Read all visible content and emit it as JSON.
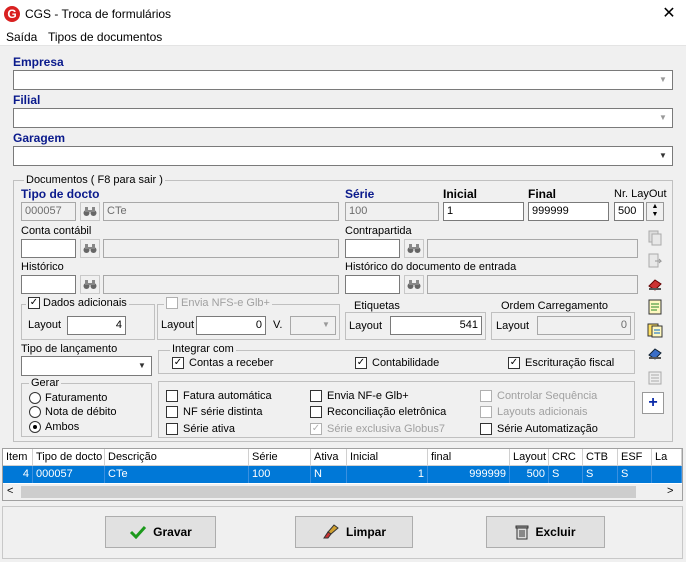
{
  "window": {
    "title": "CGS - Troca de formulários",
    "close": "✕",
    "logo_letter": "G"
  },
  "menu": [
    "Saída",
    "Tipos de documentos"
  ],
  "empresa": {
    "label": "Empresa",
    "value": ""
  },
  "filial": {
    "label": "Filial",
    "value": ""
  },
  "garagem": {
    "label": "Garagem",
    "value": ""
  },
  "documentos": {
    "legend": "Documentos ( F8 para sair )",
    "tipo_docto": {
      "label": "Tipo de docto",
      "code": "000057",
      "desc": "CTe"
    },
    "serie": {
      "label": "Série",
      "value": "100"
    },
    "inicial": {
      "label": "Inicial",
      "value": "1"
    },
    "final": {
      "label": "Final",
      "value": "999999"
    },
    "nr_layout": {
      "label": "Nr. LayOut",
      "value": "500"
    },
    "conta_contabil": {
      "label": "Conta contábil",
      "code": "",
      "desc": ""
    },
    "contrapartida": {
      "label": "Contrapartida",
      "code": "",
      "desc": ""
    },
    "historico": {
      "label": "Histórico",
      "code": "",
      "desc": ""
    },
    "historico_entrada": {
      "label": "Histórico do documento de entrada",
      "code": "",
      "desc": ""
    }
  },
  "dados_adicionais": {
    "label": "Dados adicionais",
    "checked": true,
    "layout_label": "Layout",
    "layout_value": "4"
  },
  "envia_nfs": {
    "label": "Envia NFS-e Glb+",
    "checked": false,
    "layout_label": "Layout",
    "layout_value": "0",
    "v_label": "V.",
    "v_value": ""
  },
  "etiquetas": {
    "label": "Etiquetas",
    "layout_label": "Layout",
    "layout_value": "541"
  },
  "ordem_carregamento": {
    "label": "Ordem Carregamento",
    "layout_label": "Layout",
    "layout_value": "0"
  },
  "tipo_lancamento": {
    "label": "Tipo de lançamento",
    "value": ""
  },
  "integrar": {
    "label": "Integrar com",
    "items": [
      {
        "label": "Contas a receber",
        "checked": true
      },
      {
        "label": "Contabilidade",
        "checked": true
      },
      {
        "label": "Escrituração fiscal",
        "checked": true
      }
    ]
  },
  "gerar": {
    "label": "Gerar",
    "options": [
      {
        "label": "Faturamento",
        "selected": false
      },
      {
        "label": "Nota de débito",
        "selected": false
      },
      {
        "label": "Ambos",
        "selected": true
      }
    ]
  },
  "options": {
    "fatura_automatica": {
      "label": "Fatura automática",
      "checked": false
    },
    "nf_serie_distinta": {
      "label": "NF série distinta",
      "checked": false
    },
    "serie_ativa": {
      "label": "Série ativa",
      "checked": false
    },
    "envia_nfe": {
      "label": "Envia NF-e Glb+",
      "checked": false
    },
    "reconciliacao": {
      "label": "Reconciliação eletrônica",
      "checked": false
    },
    "serie_exclusiva": {
      "label": "Série exclusiva Globus7",
      "checked": true,
      "disabled": true
    },
    "controlar_sequencia": {
      "label": "Controlar Sequência",
      "checked": false,
      "disabled": true
    },
    "layouts_adicionais": {
      "label": "Layouts adicionais",
      "checked": false,
      "disabled": true
    },
    "serie_automatizacao": {
      "label": "Série Automatização",
      "checked": false
    }
  },
  "grid": {
    "headers": [
      "Item",
      "Tipo de docto",
      "Descrição",
      "Série",
      "Ativa",
      "Inicial",
      "final",
      "Layout",
      "CRC",
      "CTB",
      "ESF",
      "La"
    ],
    "rows": [
      [
        "4",
        "000057",
        "CTe",
        "100",
        "N",
        "1",
        "999999",
        "500",
        "S",
        "S",
        "S",
        ""
      ]
    ]
  },
  "buttons": {
    "gravar": "Gravar",
    "limpar": "Limpar",
    "excluir": "Excluir"
  },
  "colors": {
    "label_blue": "#0a1a8c",
    "selection": "#0078d7"
  }
}
